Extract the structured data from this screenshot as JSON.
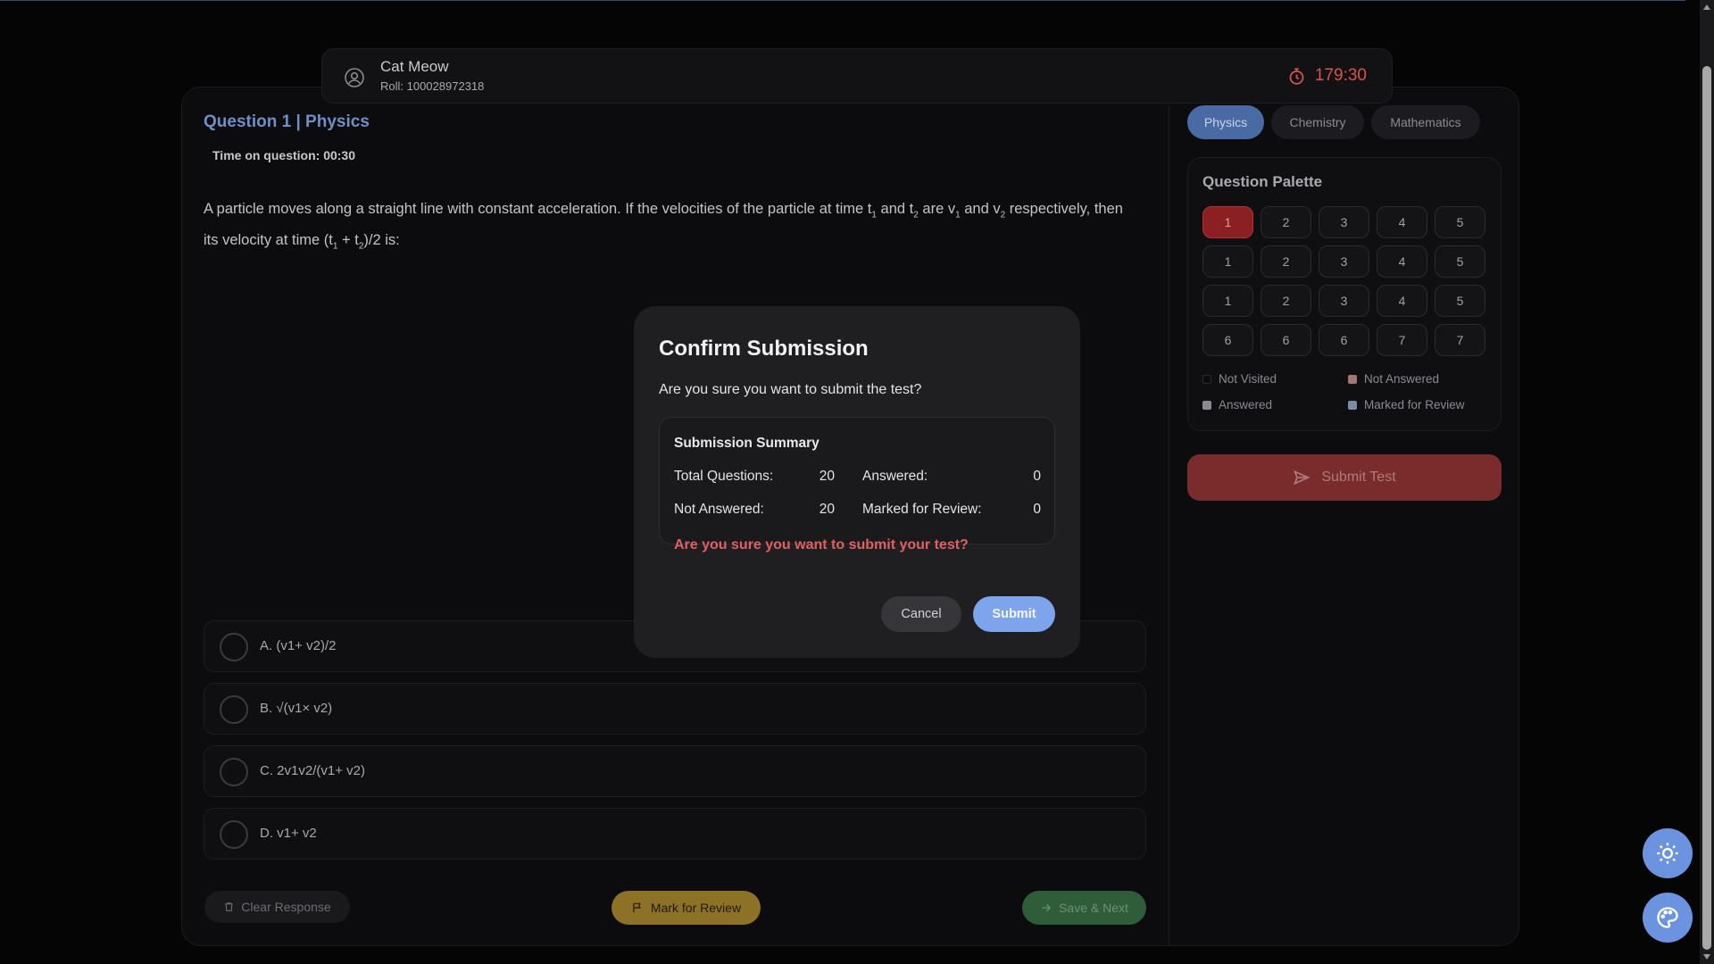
{
  "header": {
    "user_name": "Cat Meow",
    "roll": "Roll: 100028972318",
    "timer": "179:30"
  },
  "question": {
    "title": "Question 1 | Physics",
    "time_on_question": "Time on question: 00:30",
    "text_parts": {
      "p1": "A particle moves along a straight line with constant acceleration. If the velocities of the particle at time t",
      "s1": "1",
      "p2": " and t",
      "s2": "2",
      "p3": " are v",
      "s3": "1",
      "p4": " and v",
      "s4": "2",
      "p5": " respectively, then its velocity at time (t",
      "s5": "1",
      "p6": " + t",
      "s6": "2",
      "p7": ")/2 is:"
    },
    "options": [
      {
        "label": "A. (v1+ v2)/2"
      },
      {
        "label": "B. √(v1× v2)"
      },
      {
        "label": "C. 2v1v2/(v1+ v2)"
      },
      {
        "label": "D. v1+ v2"
      }
    ]
  },
  "actions": {
    "clear": "Clear Response",
    "mark": "Mark for Review",
    "save_next": "Save & Next"
  },
  "subjects": {
    "physics": "Physics",
    "chemistry": "Chemistry",
    "mathematics": "Mathematics"
  },
  "palette": {
    "title": "Question Palette",
    "buttons": [
      "1",
      "2",
      "3",
      "4",
      "5",
      "1",
      "2",
      "3",
      "4",
      "5",
      "1",
      "2",
      "3",
      "4",
      "5",
      "6",
      "6",
      "6",
      "7",
      "7"
    ],
    "legend": {
      "not_visited": "Not Visited",
      "not_answered": "Not Answered",
      "answered": "Answered",
      "marked": "Marked for Review"
    }
  },
  "submit_test": "Submit Test",
  "modal": {
    "title": "Confirm Submission",
    "message": "Are you sure you want to submit the test?",
    "summary_title": "Submission Summary",
    "total_label": "Total Questions:",
    "total_value": "20",
    "answered_label": "Answered:",
    "answered_value": "0",
    "not_answered_label": "Not Answered:",
    "not_answered_value": "20",
    "marked_label": "Marked for Review:",
    "marked_value": "0",
    "warning": "Are you sure you want to submit your test?",
    "cancel": "Cancel",
    "submit": "Submit"
  },
  "colors": {
    "accent_blue": "#6b93e0",
    "danger_red": "#d9534f",
    "current_question": "#8b1f22",
    "mark_review": "#8c7126",
    "save_next": "#2f5d3a"
  },
  "icons": [
    "user-icon",
    "timer-icon",
    "trash-icon",
    "flag-icon",
    "arrow-right-icon",
    "send-icon",
    "sun-icon",
    "palette-icon"
  ]
}
